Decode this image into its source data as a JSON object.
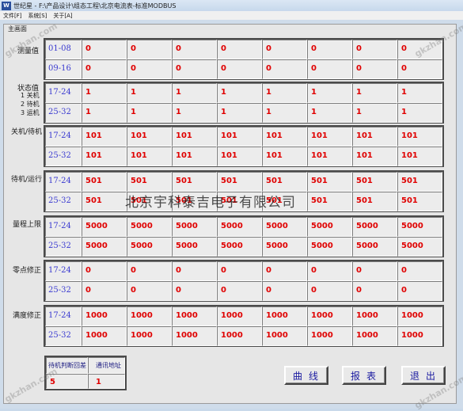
{
  "window": {
    "title": "世纪星 - F:\\产品设计\\组态工程\\北京电流表-标准MODBUS",
    "menu": [
      "文件[F]",
      "系统[S]",
      "关于[A]"
    ],
    "panel_title": "主画面"
  },
  "columns": 8,
  "sections": [
    {
      "label": "测量值",
      "rows": [
        {
          "range": "01-08",
          "values": [
            "0",
            "0",
            "0",
            "0",
            "0",
            "0",
            "0",
            "0"
          ]
        },
        {
          "range": "09-16",
          "values": [
            "0",
            "0",
            "0",
            "0",
            "0",
            "0",
            "0",
            "0"
          ]
        }
      ]
    },
    {
      "label": "状态值\n1 关机\n2 待机\n3 运机",
      "rows": [
        {
          "range": "17-24",
          "values": [
            "1",
            "1",
            "1",
            "1",
            "1",
            "1",
            "1",
            "1"
          ]
        },
        {
          "range": "25-32",
          "values": [
            "1",
            "1",
            "1",
            "1",
            "1",
            "1",
            "1",
            "1"
          ]
        }
      ]
    },
    {
      "label": "关机/待机",
      "rows": [
        {
          "range": "17-24",
          "values": [
            "101",
            "101",
            "101",
            "101",
            "101",
            "101",
            "101",
            "101"
          ]
        },
        {
          "range": "25-32",
          "values": [
            "101",
            "101",
            "101",
            "101",
            "101",
            "101",
            "101",
            "101"
          ]
        }
      ]
    },
    {
      "label": "待机/运行",
      "rows": [
        {
          "range": "17-24",
          "values": [
            "501",
            "501",
            "501",
            "501",
            "501",
            "501",
            "501",
            "501"
          ]
        },
        {
          "range": "25-32",
          "values": [
            "501",
            "501",
            "501",
            "501",
            "501",
            "501",
            "501",
            "501"
          ]
        }
      ]
    },
    {
      "label": "量程上限",
      "rows": [
        {
          "range": "17-24",
          "values": [
            "5000",
            "5000",
            "5000",
            "5000",
            "5000",
            "5000",
            "5000",
            "5000"
          ]
        },
        {
          "range": "25-32",
          "values": [
            "5000",
            "5000",
            "5000",
            "5000",
            "5000",
            "5000",
            "5000",
            "5000"
          ]
        }
      ]
    },
    {
      "label": "零点修正",
      "rows": [
        {
          "range": "17-24",
          "values": [
            "0",
            "0",
            "0",
            "0",
            "0",
            "0",
            "0",
            "0"
          ]
        },
        {
          "range": "25-32",
          "values": [
            "0",
            "0",
            "0",
            "0",
            "0",
            "0",
            "0",
            "0"
          ]
        }
      ]
    },
    {
      "label": "满度修正",
      "rows": [
        {
          "range": "17-24",
          "values": [
            "1000",
            "1000",
            "1000",
            "1000",
            "1000",
            "1000",
            "1000",
            "1000"
          ]
        },
        {
          "range": "25-32",
          "values": [
            "1000",
            "1000",
            "1000",
            "1000",
            "1000",
            "1000",
            "1000",
            "1000"
          ]
        }
      ]
    }
  ],
  "settings": {
    "standby_diff_label": "待机判断回差",
    "address_label": "通讯地址",
    "standby_diff_value": "5",
    "address_value": "1"
  },
  "buttons": {
    "curve": "曲线",
    "report": "报表",
    "exit": "退出"
  },
  "watermark": "北京宇科泰吉电子有限公司",
  "watermark_corner": "gkzhan.com"
}
